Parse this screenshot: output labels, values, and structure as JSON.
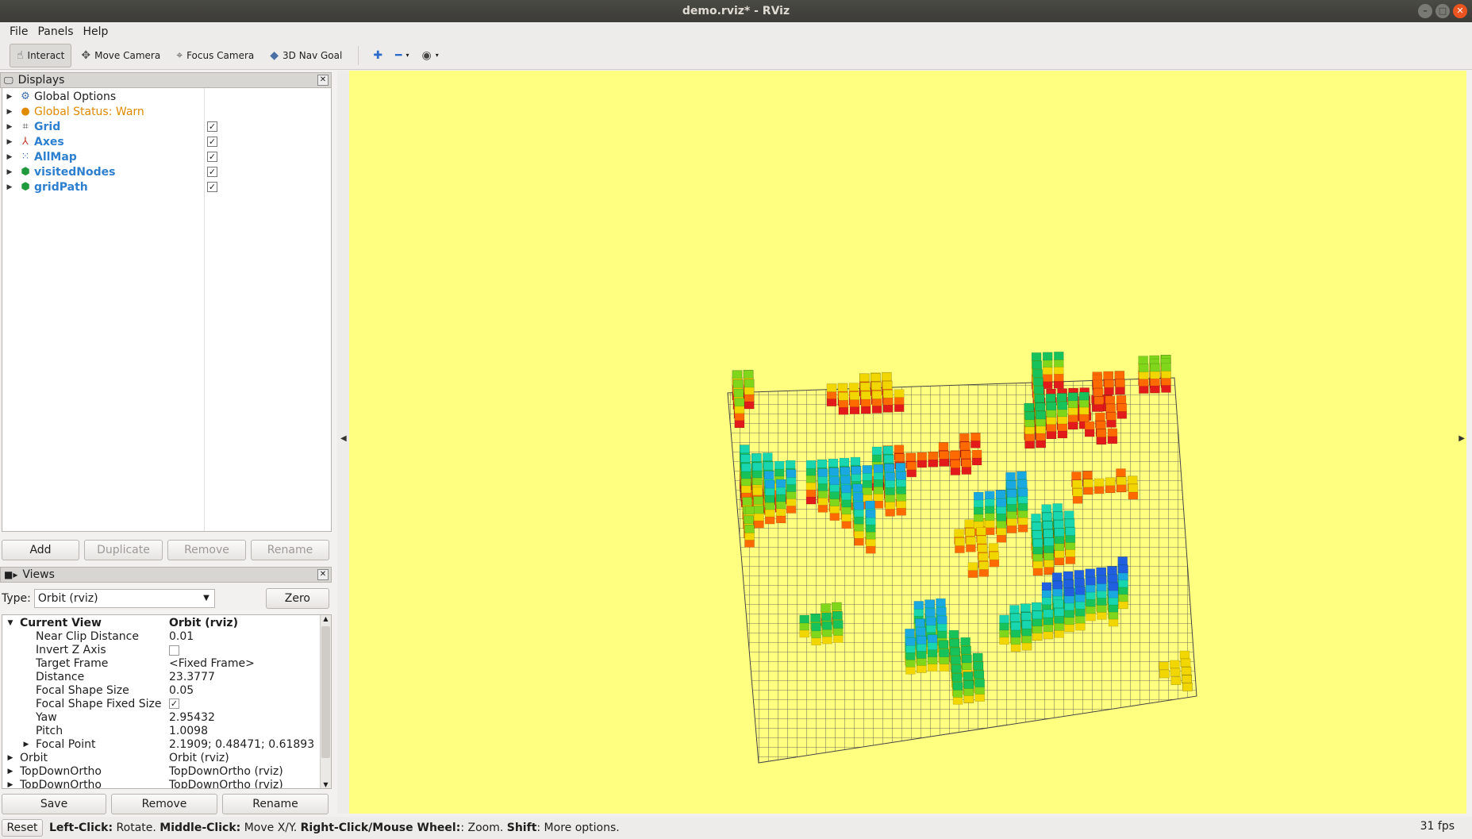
{
  "window": {
    "title": "demo.rviz* - RViz"
  },
  "menu": {
    "items": [
      "File",
      "Panels",
      "Help"
    ]
  },
  "toolbar": {
    "interact": "Interact",
    "move_camera": "Move Camera",
    "focus_camera": "Focus Camera",
    "nav_goal": "3D Nav Goal"
  },
  "displays": {
    "title": "Displays",
    "items": [
      {
        "label": "Global Options",
        "checked": null
      },
      {
        "label": "Global Status: Warn",
        "checked": null
      },
      {
        "label": "Grid",
        "checked": true
      },
      {
        "label": "Axes",
        "checked": true
      },
      {
        "label": "AllMap",
        "checked": true
      },
      {
        "label": "visitedNodes",
        "checked": true
      },
      {
        "label": "gridPath",
        "checked": true
      }
    ],
    "buttons": {
      "add": "Add",
      "duplicate": "Duplicate",
      "remove": "Remove",
      "rename": "Rename"
    }
  },
  "views": {
    "title": "Views",
    "type_label": "Type:",
    "type_value": "Orbit (rviz)",
    "zero": "Zero",
    "current_view": {
      "key": "Current View",
      "value": "Orbit (rviz)"
    },
    "props": [
      {
        "key": "Near Clip Distance",
        "value": "0.01"
      },
      {
        "key": "Invert Z Axis",
        "value": ""
      },
      {
        "key": "Target Frame",
        "value": "<Fixed Frame>"
      },
      {
        "key": "Distance",
        "value": "23.3777"
      },
      {
        "key": "Focal Shape Size",
        "value": "0.05"
      },
      {
        "key": "Focal Shape Fixed Size",
        "value": ""
      },
      {
        "key": "Yaw",
        "value": "2.95432"
      },
      {
        "key": "Pitch",
        "value": "1.0098"
      },
      {
        "key": "Focal Point",
        "value": "2.1909; 0.48471; 0.61893"
      }
    ],
    "saved": [
      {
        "key": "Orbit",
        "value": "Orbit (rviz)"
      },
      {
        "key": "TopDownOrtho",
        "value": "TopDownOrtho (rviz)"
      },
      {
        "key": "TopDownOrtho",
        "value": "TopDownOrtho (rviz)"
      }
    ],
    "buttons": {
      "save": "Save",
      "remove": "Remove",
      "rename": "Rename"
    }
  },
  "status": {
    "reset": "Reset",
    "hint": [
      {
        "b": "Left-Click:",
        "t": " Rotate. "
      },
      {
        "b": "Middle-Click:",
        "t": " Move X/Y. "
      },
      {
        "b": "Right-Click/Mouse Wheel:",
        "t": ": Zoom. "
      },
      {
        "b": "Shift",
        "t": ": More options."
      }
    ],
    "fps": "31 fps"
  },
  "colors": {
    "viewport_bg": "#ffff80",
    "link": "#2d7fcf",
    "warn": "#e08a00"
  }
}
